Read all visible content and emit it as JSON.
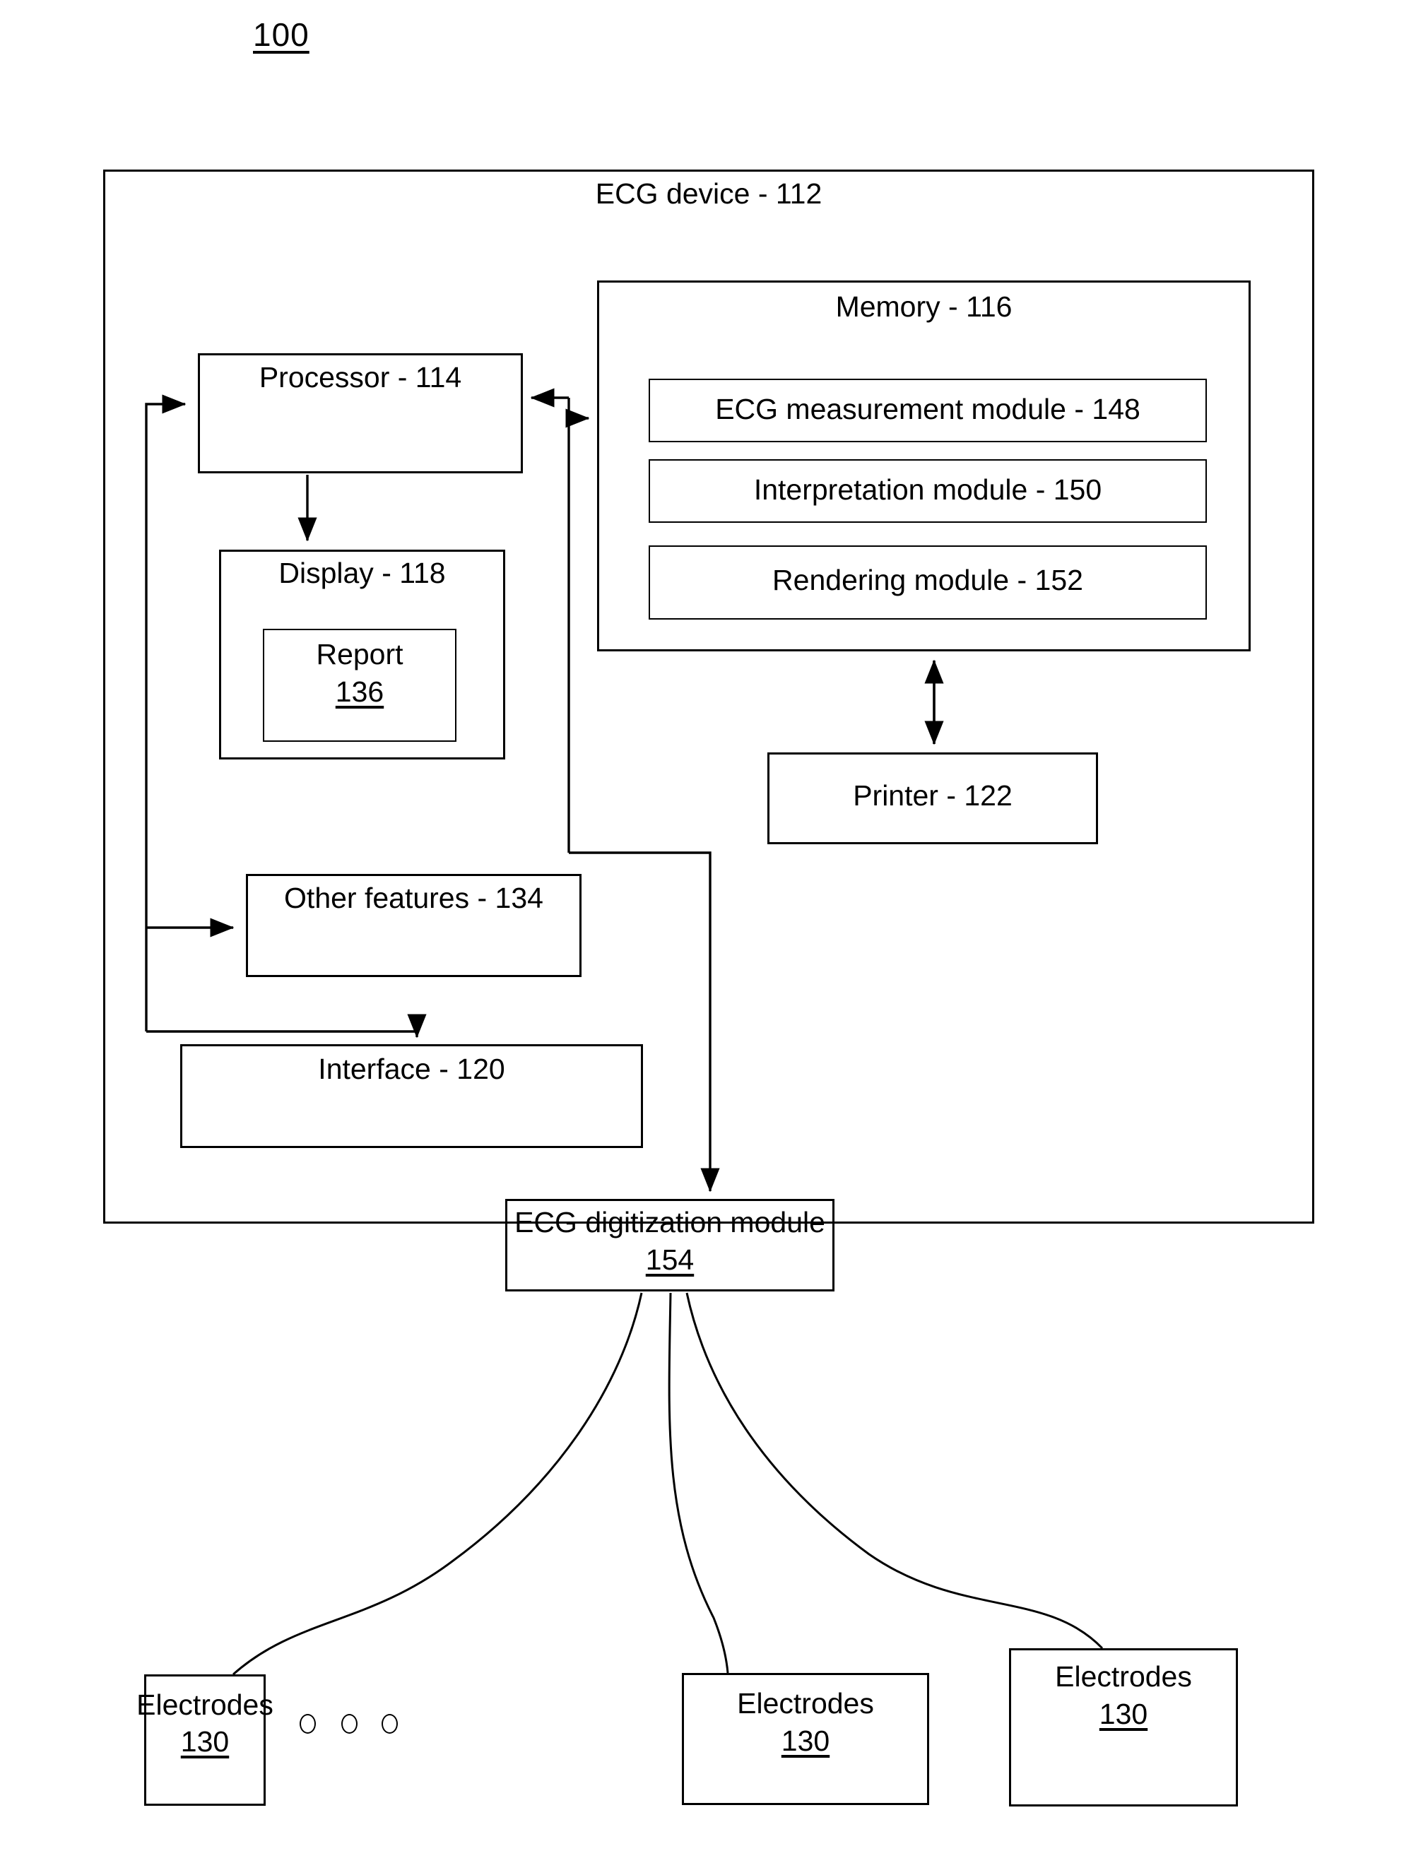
{
  "figure": {
    "number": "100"
  },
  "outer": {
    "title": "ECG device - 112"
  },
  "blocks": {
    "processor": {
      "label": "Processor - 114"
    },
    "memory": {
      "label": "Memory - 116"
    },
    "ecg_measurement_module": {
      "label": "ECG measurement module - 148"
    },
    "interpretation_module": {
      "label": "Interpretation module - 150"
    },
    "rendering_module": {
      "label": "Rendering module - 152"
    },
    "display": {
      "label": "Display - 118"
    },
    "report": {
      "label": "Report",
      "ref": "136"
    },
    "printer": {
      "label": "Printer - 122"
    },
    "other_features": {
      "label": "Other features - 134"
    },
    "interface": {
      "label": "Interface - 120"
    },
    "ecg_digitization_module": {
      "label": "ECG digitization module",
      "ref": "154"
    },
    "electrodes_left": {
      "label": "Electrodes",
      "ref": "130"
    },
    "electrodes_middle": {
      "label": "Electrodes",
      "ref": "130"
    },
    "electrodes_right": {
      "label": "Electrodes",
      "ref": "130"
    }
  },
  "ellipsis": {
    "dots": [
      "dot-1",
      "dot-2",
      "dot-3"
    ]
  },
  "colors": {
    "stroke": "#000000",
    "background": "#ffffff"
  }
}
